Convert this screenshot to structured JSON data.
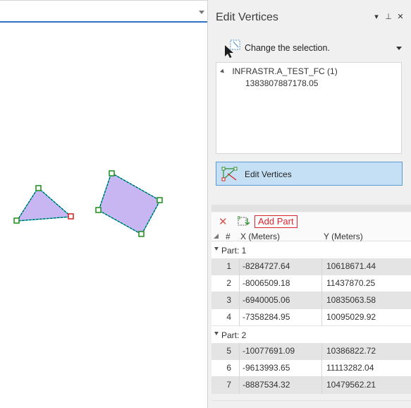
{
  "map": {
    "tab_dropdown_icon": "chevron-down-icon",
    "polygon_fill": "#c8b6f2",
    "vertex_green": "#1a8c1a",
    "vertex_red": "#d31f1f"
  },
  "pane": {
    "title": "Edit Vertices",
    "controls": {
      "menu": "▾",
      "pin": "⊥",
      "close": "✕"
    }
  },
  "selection": {
    "label": "Change the selection."
  },
  "tree": {
    "layer": "INFRASTR.A_TEST_FC (1)",
    "feature": "1383807887178.05"
  },
  "edit_button": {
    "label": "Edit Vertices",
    "accent": "#c5e0f5"
  },
  "toolbar": {
    "delete_icon": "close-icon",
    "add_part_label": "Add Part"
  },
  "table": {
    "headers": {
      "num": "#",
      "x": "X (Meters)",
      "y": "Y (Meters)"
    },
    "parts": [
      {
        "label": "Part: 1",
        "rows": [
          {
            "n": "1",
            "x": "-8284727.64",
            "y": "10618671.44"
          },
          {
            "n": "2",
            "x": "-8006509.18",
            "y": "11437870.25"
          },
          {
            "n": "3",
            "x": "-6940005.06",
            "y": "10835063.58"
          },
          {
            "n": "4",
            "x": "-7358284.95",
            "y": "10095029.92"
          }
        ]
      },
      {
        "label": "Part: 2",
        "rows": [
          {
            "n": "5",
            "x": "-10077691.09",
            "y": "10386822.72"
          },
          {
            "n": "6",
            "x": "-9613993.65",
            "y": "11113282.04"
          },
          {
            "n": "7",
            "x": "-8887534.32",
            "y": "10479562.21"
          }
        ]
      }
    ]
  }
}
